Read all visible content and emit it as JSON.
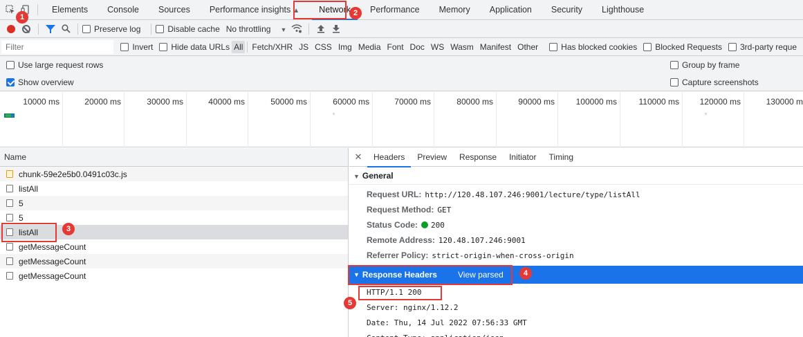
{
  "tabs": [
    "Elements",
    "Console",
    "Sources",
    "Performance insights",
    "Network",
    "Performance",
    "Memory",
    "Application",
    "Security",
    "Lighthouse"
  ],
  "active_tab": "Network",
  "toolbar": {
    "preserve_log": "Preserve log",
    "disable_cache": "Disable cache",
    "throttling": "No throttling"
  },
  "filter": {
    "placeholder": "Filter",
    "invert": "Invert",
    "hide_data_urls": "Hide data URLs",
    "types": [
      "All",
      "Fetch/XHR",
      "JS",
      "CSS",
      "Img",
      "Media",
      "Font",
      "Doc",
      "WS",
      "Wasm",
      "Manifest",
      "Other"
    ],
    "has_blocked_cookies": "Has blocked cookies",
    "blocked_requests": "Blocked Requests",
    "third_party": "3rd-party reque"
  },
  "settings": {
    "large_rows": "Use large request rows",
    "show_overview": "Show overview",
    "group_by_frame": "Group by frame",
    "capture_screenshots": "Capture screenshots"
  },
  "overview_ticks": [
    "10000 ms",
    "20000 ms",
    "30000 ms",
    "40000 ms",
    "50000 ms",
    "60000 ms",
    "70000 ms",
    "80000 ms",
    "90000 ms",
    "100000 ms",
    "110000 ms",
    "120000 ms",
    "130000 m"
  ],
  "requests_header": "Name",
  "requests": [
    {
      "name": "chunk-59e2e5b0.0491c03c.js",
      "type": "js"
    },
    {
      "name": "listAll",
      "type": "doc"
    },
    {
      "name": "5",
      "type": "doc"
    },
    {
      "name": "5",
      "type": "doc"
    },
    {
      "name": "listAll",
      "type": "doc",
      "selected": true
    },
    {
      "name": "getMessageCount",
      "type": "doc"
    },
    {
      "name": "getMessageCount",
      "type": "doc"
    },
    {
      "name": "getMessageCount",
      "type": "doc"
    }
  ],
  "detail_tabs": [
    "Headers",
    "Preview",
    "Response",
    "Initiator",
    "Timing"
  ],
  "general": {
    "title": "General",
    "rows": [
      {
        "k": "Request URL:",
        "v": "http://120.48.107.246:9001/lecture/type/listAll"
      },
      {
        "k": "Request Method:",
        "v": "GET"
      },
      {
        "k": "Status Code:",
        "v": "200"
      },
      {
        "k": "Remote Address:",
        "v": "120.48.107.246:9001"
      },
      {
        "k": "Referrer Policy:",
        "v": "strict-origin-when-cross-origin"
      }
    ]
  },
  "response_headers": {
    "title": "Response Headers",
    "view_parsed": "View parsed",
    "lines": [
      "HTTP/1.1 200",
      "Server: nginx/1.12.2",
      "Date: Thu, 14 Jul 2022 07:56:33 GMT",
      "Content-Type: application/json"
    ]
  },
  "badges": [
    "1",
    "2",
    "3",
    "4",
    "5"
  ]
}
